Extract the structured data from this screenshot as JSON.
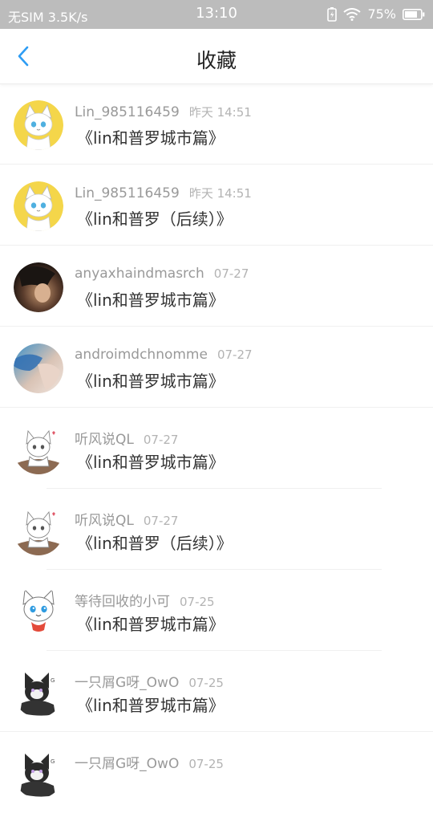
{
  "status_bar": {
    "carrier": "无SIM 3.5K/s",
    "time": "13:10",
    "battery": "75%"
  },
  "header": {
    "title": "收藏"
  },
  "items": [
    {
      "user": "Lin_985116459",
      "time": "昨天 14:51",
      "title": "《lin和普罗城市篇》",
      "avatar": "cat-yellow-avatar"
    },
    {
      "user": "Lin_985116459",
      "time": "昨天 14:51",
      "title": "《lin和普罗（后续）》",
      "avatar": "cat-yellow-avatar"
    },
    {
      "user": "anyaxhaindmasrch",
      "time": "07-27",
      "title": "《lin和普罗城市篇》",
      "avatar": "photo-dark-avatar"
    },
    {
      "user": "androimdchnomme",
      "time": "07-27",
      "title": "《lin和普罗城市篇》",
      "avatar": "photo-blue-avatar"
    },
    {
      "user": "听风说QL",
      "time": "07-27",
      "title": "《lin和普罗城市篇》",
      "avatar": "fox-sketch-avatar"
    },
    {
      "user": "听风说QL",
      "time": "07-27",
      "title": "《lin和普罗（后续）》",
      "avatar": "fox-sketch-avatar"
    },
    {
      "user": "等待回收的小可",
      "time": "07-25",
      "title": "《lin和普罗城市篇》",
      "avatar": "fox-blue-avatar"
    },
    {
      "user": "一只屑G呀_OwO",
      "time": "07-25",
      "title": "《lin和普罗城市篇》",
      "avatar": "wolf-dark-avatar"
    },
    {
      "user": "一只屑G呀_OwO",
      "time": "07-25",
      "title": "",
      "avatar": "wolf-dark-avatar"
    }
  ],
  "colors": {
    "accent": "#2e9df4",
    "status_bar": "#bcbcbc",
    "meta_text": "#999999"
  }
}
